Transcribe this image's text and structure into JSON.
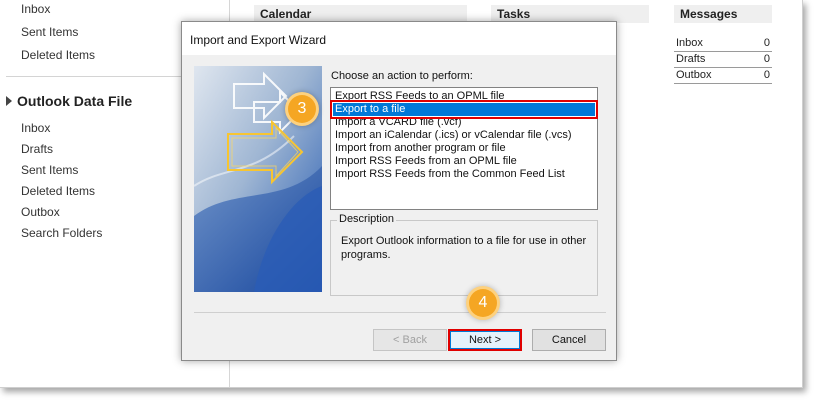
{
  "nav": {
    "top_items": [
      "Inbox",
      "Sent Items",
      "Deleted Items"
    ],
    "data_file_header": "Outlook Data File",
    "data_file_items": [
      "Inbox",
      "Drafts",
      "Sent Items",
      "Deleted Items",
      "Outbox",
      "Search Folders"
    ]
  },
  "panes": {
    "calendar": "Calendar",
    "tasks": "Tasks",
    "messages": "Messages",
    "message_rows": [
      {
        "label": "Inbox",
        "count": "0"
      },
      {
        "label": "Drafts",
        "count": "0"
      },
      {
        "label": "Outbox",
        "count": "0"
      }
    ]
  },
  "dialog": {
    "title": "Import and Export Wizard",
    "action_prompt": "Choose an action to perform:",
    "actions": [
      "Export RSS Feeds to an OPML file",
      "Export to a file",
      "Import a VCARD file (.vcf)",
      "Import an iCalendar (.ics) or vCalendar file (.vcs)",
      "Import from another program or file",
      "Import RSS Feeds from an OPML file",
      "Import RSS Feeds from the Common Feed List"
    ],
    "selected_index": 1,
    "description_label": "Description",
    "description_text": "Export Outlook information to a file for use in other programs.",
    "back_label": "< Back",
    "next_label": "Next >",
    "cancel_label": "Cancel"
  },
  "badges": {
    "step3": "3",
    "step4": "4"
  },
  "colors": {
    "selection": "#0078d7",
    "highlight_box": "#e00000",
    "badge": "#f5a623"
  }
}
